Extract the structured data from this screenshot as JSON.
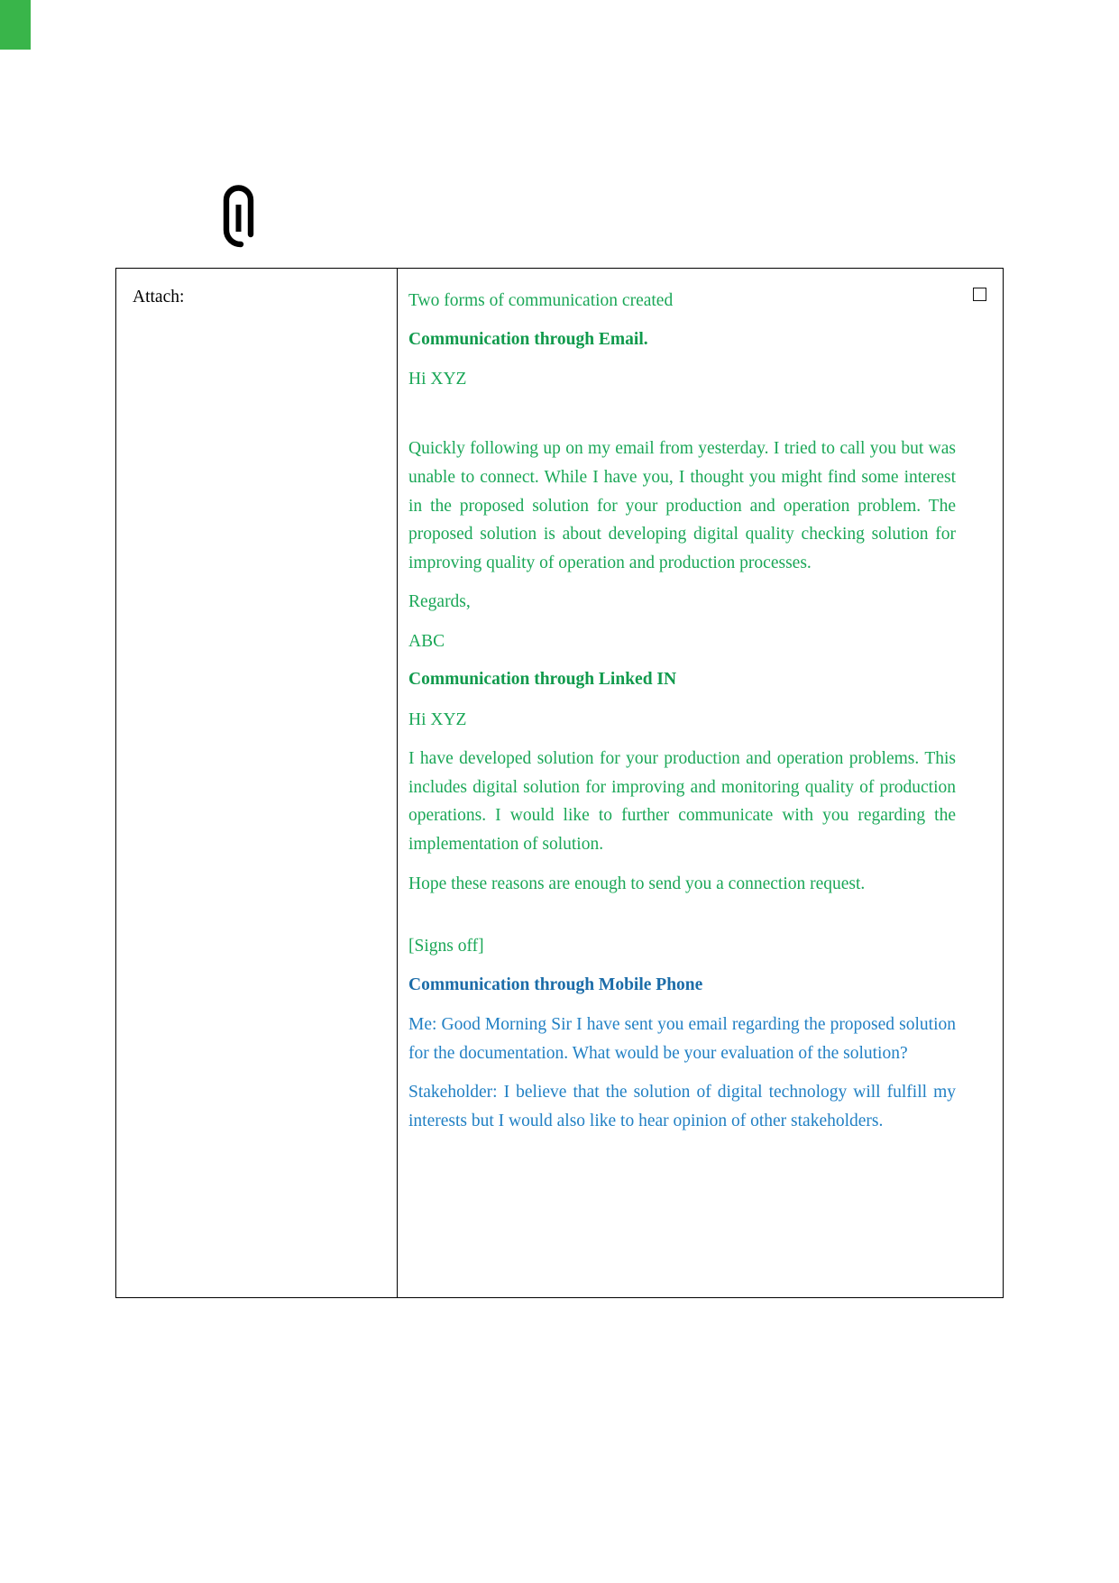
{
  "document": {
    "marker_color": "#39b54a",
    "accent_green": "#1aa757",
    "accent_green_heading": "#109a4c",
    "accent_blue": "#2180c4",
    "accent_blue_heading": "#1b6ca8",
    "paperclip_icon": "paperclip-icon",
    "checkbox_icon": "empty-checkbox-icon"
  },
  "table": {
    "left_cell": {
      "label": "Attach:"
    },
    "right_cell": {
      "intro": "Two forms of communication created",
      "sections": [
        {
          "heading": "Communication through Email.",
          "color": "green",
          "paragraphs": [
            "Hi XYZ",
            "Quickly following up on my email from yesterday. I tried to call you but was unable to connect. While I have you, I thought you might find some interest in the proposed solution for your production and operation problem.  The proposed solution is about developing digital quality checking solution for improving quality of operation and production processes.",
            "Regards,",
            "ABC"
          ]
        },
        {
          "heading": "Communication through Linked IN",
          "color": "green",
          "paragraphs": [
            "Hi XYZ",
            "I have developed solution for your production and operation problems. This includes digital solution for improving and monitoring quality of production operations. I would like to further communicate with you regarding the implementation of solution.",
            "Hope these reasons are enough to send you a connection request.",
            "[Signs off]"
          ]
        },
        {
          "heading": "Communication through Mobile Phone",
          "color": "blue",
          "paragraphs": [
            "Me: Good Morning Sir I have sent you email regarding the proposed solution for the documentation. What would be your evaluation of the solution?",
            "Stakeholder: I believe that the solution of digital technology will fulfill my interests but I would also like to hear opinion of other stakeholders."
          ]
        }
      ]
    }
  }
}
